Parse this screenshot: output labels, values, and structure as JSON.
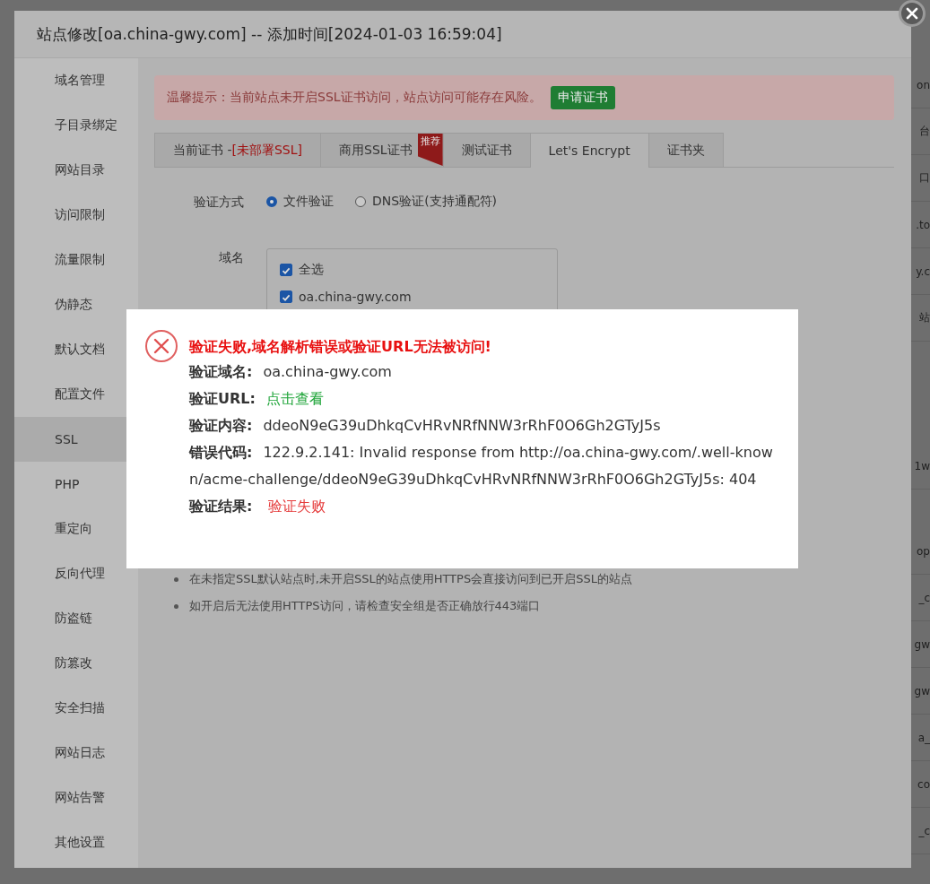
{
  "background_page": {
    "row_fragments": [
      "on",
      "台",
      "口",
      ".to",
      "y.c",
      "站",
      "1w",
      "op",
      "_c",
      "gw",
      "gw",
      "a_",
      "co",
      "_c"
    ]
  },
  "dialog": {
    "title": "站点修改[oa.china-gwy.com] -- 添加时间[2024-01-03 16:59:04]",
    "sidebar": {
      "items": [
        {
          "label": "域名管理",
          "selected": false
        },
        {
          "label": "子目录绑定",
          "selected": false
        },
        {
          "label": "网站目录",
          "selected": false
        },
        {
          "label": "访问限制",
          "selected": false
        },
        {
          "label": "流量限制",
          "selected": false
        },
        {
          "label": "伪静态",
          "selected": false
        },
        {
          "label": "默认文档",
          "selected": false
        },
        {
          "label": "配置文件",
          "selected": false
        },
        {
          "label": "SSL",
          "selected": true
        },
        {
          "label": "PHP",
          "selected": false
        },
        {
          "label": "重定向",
          "selected": false
        },
        {
          "label": "反向代理",
          "selected": false
        },
        {
          "label": "防盗链",
          "selected": false
        },
        {
          "label": "防篡改",
          "selected": false
        },
        {
          "label": "安全扫描",
          "selected": false
        },
        {
          "label": "网站日志",
          "selected": false
        },
        {
          "label": "网站告警",
          "selected": false
        },
        {
          "label": "其他设置",
          "selected": false
        }
      ]
    },
    "alert": {
      "text": "温馨提示：当前站点未开启SSL证书访问，站点访问可能存在风险。",
      "button": "申请证书"
    },
    "tabs": [
      {
        "label": "当前证书 - ",
        "status": "[未部署SSL]",
        "selected": false
      },
      {
        "label": "商用SSL证书",
        "badge": "推荐",
        "selected": false
      },
      {
        "label": "测试证书",
        "selected": false
      },
      {
        "label": "Let's Encrypt",
        "selected": true
      },
      {
        "label": "证书夹",
        "selected": false
      }
    ],
    "verify_method": {
      "label": "验证方式",
      "options": [
        {
          "label": "文件验证",
          "selected": true
        },
        {
          "label": "DNS验证(支持通配符)",
          "selected": false
        }
      ]
    },
    "domains": {
      "label": "域名",
      "options": [
        {
          "label": "全选",
          "checked": true
        },
        {
          "label": "oa.china-gwy.com",
          "checked": true
        }
      ]
    },
    "notes": [
      "在未指定SSL默认站点时,未开启SSL的站点使用HTTPS会直接访问到已开启SSL的站点",
      "如开启后无法使用HTTPS访问，请检查安全组是否正确放行443端口"
    ]
  },
  "error_popup": {
    "title": "验证失败,域名解析错误或验证URL无法被访问!",
    "fields": [
      {
        "label": "验证域名:",
        "value": "oa.china-gwy.com",
        "kind": "plain"
      },
      {
        "label": "验证URL:",
        "value": "点击查看",
        "kind": "link"
      },
      {
        "label": "验证内容:",
        "value": "ddeoN9eG39uDhkqCvHRvNRfNNW3rRhF0O6Gh2GTyJ5s",
        "kind": "plain"
      },
      {
        "label": "错误代码:",
        "value": "122.9.2.141: Invalid response from http://oa.china-gwy.com/.well-known/acme-challenge/ddeoN9eG39uDhkqCvHRvNRfNNW3rRhF0O6Gh2GTyJ5s: 404",
        "kind": "plain"
      },
      {
        "label": "验证结果:",
        "value": "验证失败",
        "kind": "error"
      }
    ]
  }
}
